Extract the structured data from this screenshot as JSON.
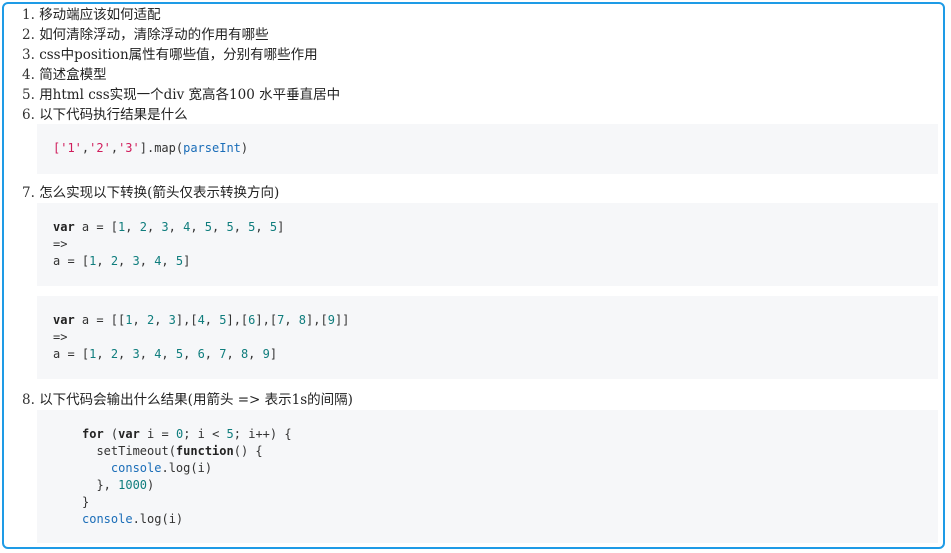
{
  "questions": [
    {
      "num": "1.",
      "text": "移动端应该如何适配"
    },
    {
      "num": "2.",
      "text": "如何清除浮动，清除浮动的作用有哪些"
    },
    {
      "num": "3.",
      "text": "css中position属性有哪些值，分别有哪些作用"
    },
    {
      "num": "4.",
      "text": "简述盒模型"
    },
    {
      "num": "5.",
      "text": "用html css实现一个div 宽高各100 水平垂直居中"
    },
    {
      "num": "6.",
      "text": "以下代码执行结果是什么"
    },
    {
      "num": "7.",
      "text": "怎么实现以下转换(箭头仅表示转换方向)"
    },
    {
      "num": "8.",
      "text": "以下代码会输出什么结果(用箭头 => 表示1s的间隔)"
    }
  ],
  "code_blocks": {
    "q6": [
      [
        {
          "t": "['1'",
          "c": "str"
        },
        {
          "t": ",",
          "c": ""
        },
        {
          "t": "'2'",
          "c": "str"
        },
        {
          "t": ",",
          "c": ""
        },
        {
          "t": "'3'",
          "c": "str"
        },
        {
          "t": "].map(",
          "c": ""
        },
        {
          "t": "parseInt",
          "c": "fn"
        },
        {
          "t": ")",
          "c": ""
        }
      ]
    ],
    "q7a": [
      [
        {
          "t": "var",
          "c": "kw"
        },
        {
          "t": " a = [",
          "c": ""
        },
        {
          "t": "1",
          "c": "num-lit"
        },
        {
          "t": ", ",
          "c": ""
        },
        {
          "t": "2",
          "c": "num-lit"
        },
        {
          "t": ", ",
          "c": ""
        },
        {
          "t": "3",
          "c": "num-lit"
        },
        {
          "t": ", ",
          "c": ""
        },
        {
          "t": "4",
          "c": "num-lit"
        },
        {
          "t": ", ",
          "c": ""
        },
        {
          "t": "5",
          "c": "num-lit"
        },
        {
          "t": ", ",
          "c": ""
        },
        {
          "t": "5",
          "c": "num-lit"
        },
        {
          "t": ", ",
          "c": ""
        },
        {
          "t": "5",
          "c": "num-lit"
        },
        {
          "t": ", ",
          "c": ""
        },
        {
          "t": "5",
          "c": "num-lit"
        },
        {
          "t": "]",
          "c": ""
        }
      ],
      [
        {
          "t": "=>",
          "c": ""
        }
      ],
      [
        {
          "t": "a = [",
          "c": ""
        },
        {
          "t": "1",
          "c": "num-lit"
        },
        {
          "t": ", ",
          "c": ""
        },
        {
          "t": "2",
          "c": "num-lit"
        },
        {
          "t": ", ",
          "c": ""
        },
        {
          "t": "3",
          "c": "num-lit"
        },
        {
          "t": ", ",
          "c": ""
        },
        {
          "t": "4",
          "c": "num-lit"
        },
        {
          "t": ", ",
          "c": ""
        },
        {
          "t": "5",
          "c": "num-lit"
        },
        {
          "t": "]",
          "c": ""
        }
      ]
    ],
    "q7b": [
      [
        {
          "t": "var",
          "c": "kw"
        },
        {
          "t": " a = [[",
          "c": ""
        },
        {
          "t": "1",
          "c": "num-lit"
        },
        {
          "t": ", ",
          "c": ""
        },
        {
          "t": "2",
          "c": "num-lit"
        },
        {
          "t": ", ",
          "c": ""
        },
        {
          "t": "3",
          "c": "num-lit"
        },
        {
          "t": "],[",
          "c": ""
        },
        {
          "t": "4",
          "c": "num-lit"
        },
        {
          "t": ", ",
          "c": ""
        },
        {
          "t": "5",
          "c": "num-lit"
        },
        {
          "t": "],[",
          "c": ""
        },
        {
          "t": "6",
          "c": "num-lit"
        },
        {
          "t": "],[",
          "c": ""
        },
        {
          "t": "7",
          "c": "num-lit"
        },
        {
          "t": ", ",
          "c": ""
        },
        {
          "t": "8",
          "c": "num-lit"
        },
        {
          "t": "],[",
          "c": ""
        },
        {
          "t": "9",
          "c": "num-lit"
        },
        {
          "t": "]]",
          "c": ""
        }
      ],
      [
        {
          "t": "=>",
          "c": ""
        }
      ],
      [
        {
          "t": "a = [",
          "c": ""
        },
        {
          "t": "1",
          "c": "num-lit"
        },
        {
          "t": ", ",
          "c": ""
        },
        {
          "t": "2",
          "c": "num-lit"
        },
        {
          "t": ", ",
          "c": ""
        },
        {
          "t": "3",
          "c": "num-lit"
        },
        {
          "t": ", ",
          "c": ""
        },
        {
          "t": "4",
          "c": "num-lit"
        },
        {
          "t": ", ",
          "c": ""
        },
        {
          "t": "5",
          "c": "num-lit"
        },
        {
          "t": ", ",
          "c": ""
        },
        {
          "t": "6",
          "c": "num-lit"
        },
        {
          "t": ", ",
          "c": ""
        },
        {
          "t": "7",
          "c": "num-lit"
        },
        {
          "t": ", ",
          "c": ""
        },
        {
          "t": "8",
          "c": "num-lit"
        },
        {
          "t": ", ",
          "c": ""
        },
        {
          "t": "9",
          "c": "num-lit"
        },
        {
          "t": "]",
          "c": ""
        }
      ]
    ],
    "q8": [
      [
        {
          "t": "for",
          "c": "kw"
        },
        {
          "t": " (",
          "c": ""
        },
        {
          "t": "var",
          "c": "kw"
        },
        {
          "t": " i = ",
          "c": ""
        },
        {
          "t": "0",
          "c": "num-lit"
        },
        {
          "t": "; i < ",
          "c": ""
        },
        {
          "t": "5",
          "c": "num-lit"
        },
        {
          "t": "; i++) {",
          "c": ""
        }
      ],
      [
        {
          "t": "  setTimeout(",
          "c": ""
        },
        {
          "t": "function",
          "c": "kw"
        },
        {
          "t": "() {",
          "c": ""
        }
      ],
      [
        {
          "t": "    ",
          "c": ""
        },
        {
          "t": "console",
          "c": "fn"
        },
        {
          "t": ".log(i)",
          "c": ""
        }
      ],
      [
        {
          "t": "  }, ",
          "c": ""
        },
        {
          "t": "1000",
          "c": "num-lit"
        },
        {
          "t": ")",
          "c": ""
        }
      ],
      [
        {
          "t": "}",
          "c": ""
        }
      ],
      [
        {
          "t": "console",
          "c": "fn"
        },
        {
          "t": ".log(i)",
          "c": ""
        }
      ]
    ]
  },
  "colors": {
    "frame_border": "#1e9be6",
    "code_background": "#f6f7f9",
    "string": "#d01c5b",
    "number": "#0f7d7d",
    "builtin": "#1a6db8"
  }
}
